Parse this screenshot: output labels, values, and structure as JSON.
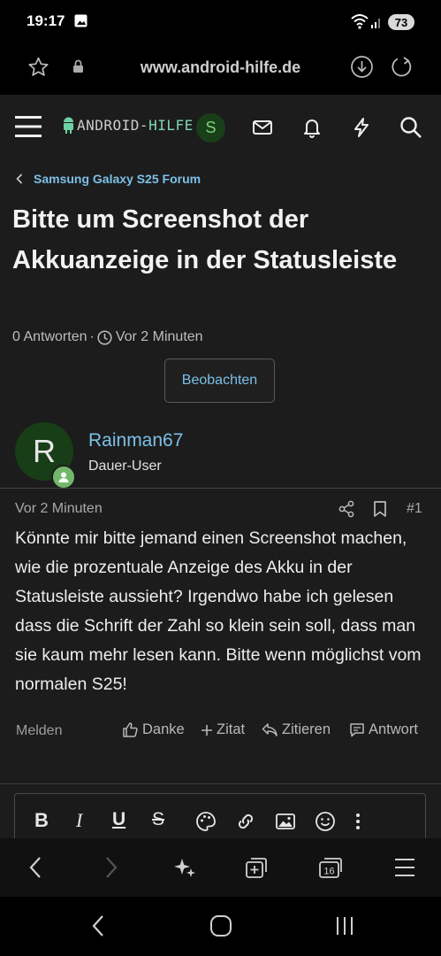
{
  "status_bar": {
    "time": "19:17",
    "battery": "73"
  },
  "browser": {
    "url": "www.android-hilfe.de",
    "tabs_count": "16"
  },
  "site_header": {
    "logo_text": "ANDROID-",
    "logo_accent": "HILFE",
    "user_initial": "S"
  },
  "breadcrumb": {
    "label": "Samsung Galaxy S25 Forum"
  },
  "thread": {
    "title": "Bitte um Screenshot der Akkuanzeige in der Statusleiste",
    "replies": "0 Antworten",
    "separator": "·",
    "time": "Vor 2 Minuten",
    "watch_label": "Beobachten"
  },
  "post": {
    "author_initial": "R",
    "author_name": "Rainman67",
    "author_role": "Dauer-User",
    "time": "Vor 2 Minuten",
    "number": "#1",
    "body": "Könnte mir bitte jemand einen Screenshot machen, wie die prozentuale Anzeige des Akku in der Statusleiste aussieht? Irgendwo habe ich gelesen dass die Schrift der Zahl so klein sein soll, dass man sie kaum mehr lesen kann. Bitte wenn möglichst vom normalen S25!",
    "actions": {
      "report": "Melden",
      "thanks": "Danke",
      "quote": "Zitat",
      "multi_quote": "Zitieren",
      "reply": "Antwort"
    }
  },
  "editor": {
    "bold": "B",
    "italic": "I",
    "underline": "U",
    "strike": "S"
  },
  "colors": {
    "link": "#7cc0e8",
    "page_bg": "#1c1c1c",
    "avatar_bg": "#173e16",
    "online": "#73b86a"
  }
}
